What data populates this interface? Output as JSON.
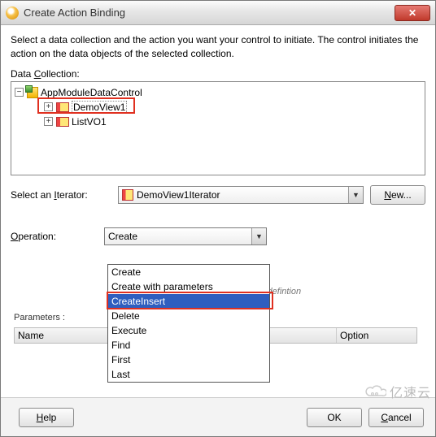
{
  "titlebar": {
    "title": "Create Action Binding"
  },
  "instruction": "Select a data collection and the action you want your control to initiate. The control initiates the action on the data objects of the selected collection.",
  "labels": {
    "data_collection": "Data Collection:",
    "iterator": "Select an Iterator:",
    "operation": "Operation:",
    "parameters": "Parameters :",
    "col_name": "Name",
    "col_value": "",
    "col_option": "Option"
  },
  "accel": {
    "data_c": "C",
    "iterator_i": "I",
    "operation_o": "O",
    "new_n": "N",
    "help_h": "H",
    "cancel_c": "C"
  },
  "tree": {
    "root": "AppModuleDataControl",
    "nodes": [
      {
        "label": "DemoView1",
        "selected": true
      },
      {
        "label": "ListVO1",
        "selected": false
      }
    ]
  },
  "iterator": {
    "value": "DemoView1Iterator"
  },
  "operation": {
    "value": "Create",
    "items": [
      "Create",
      "Create with parameters",
      "CreateInsert",
      "Delete",
      "Execute",
      "Find",
      "First",
      "Last"
    ],
    "highlighted": "CreateInsert"
  },
  "hint_text": "page defintion",
  "buttons": {
    "new": "New...",
    "help": "Help",
    "ok": "OK",
    "cancel": "Cancel"
  },
  "watermark": "亿速云"
}
